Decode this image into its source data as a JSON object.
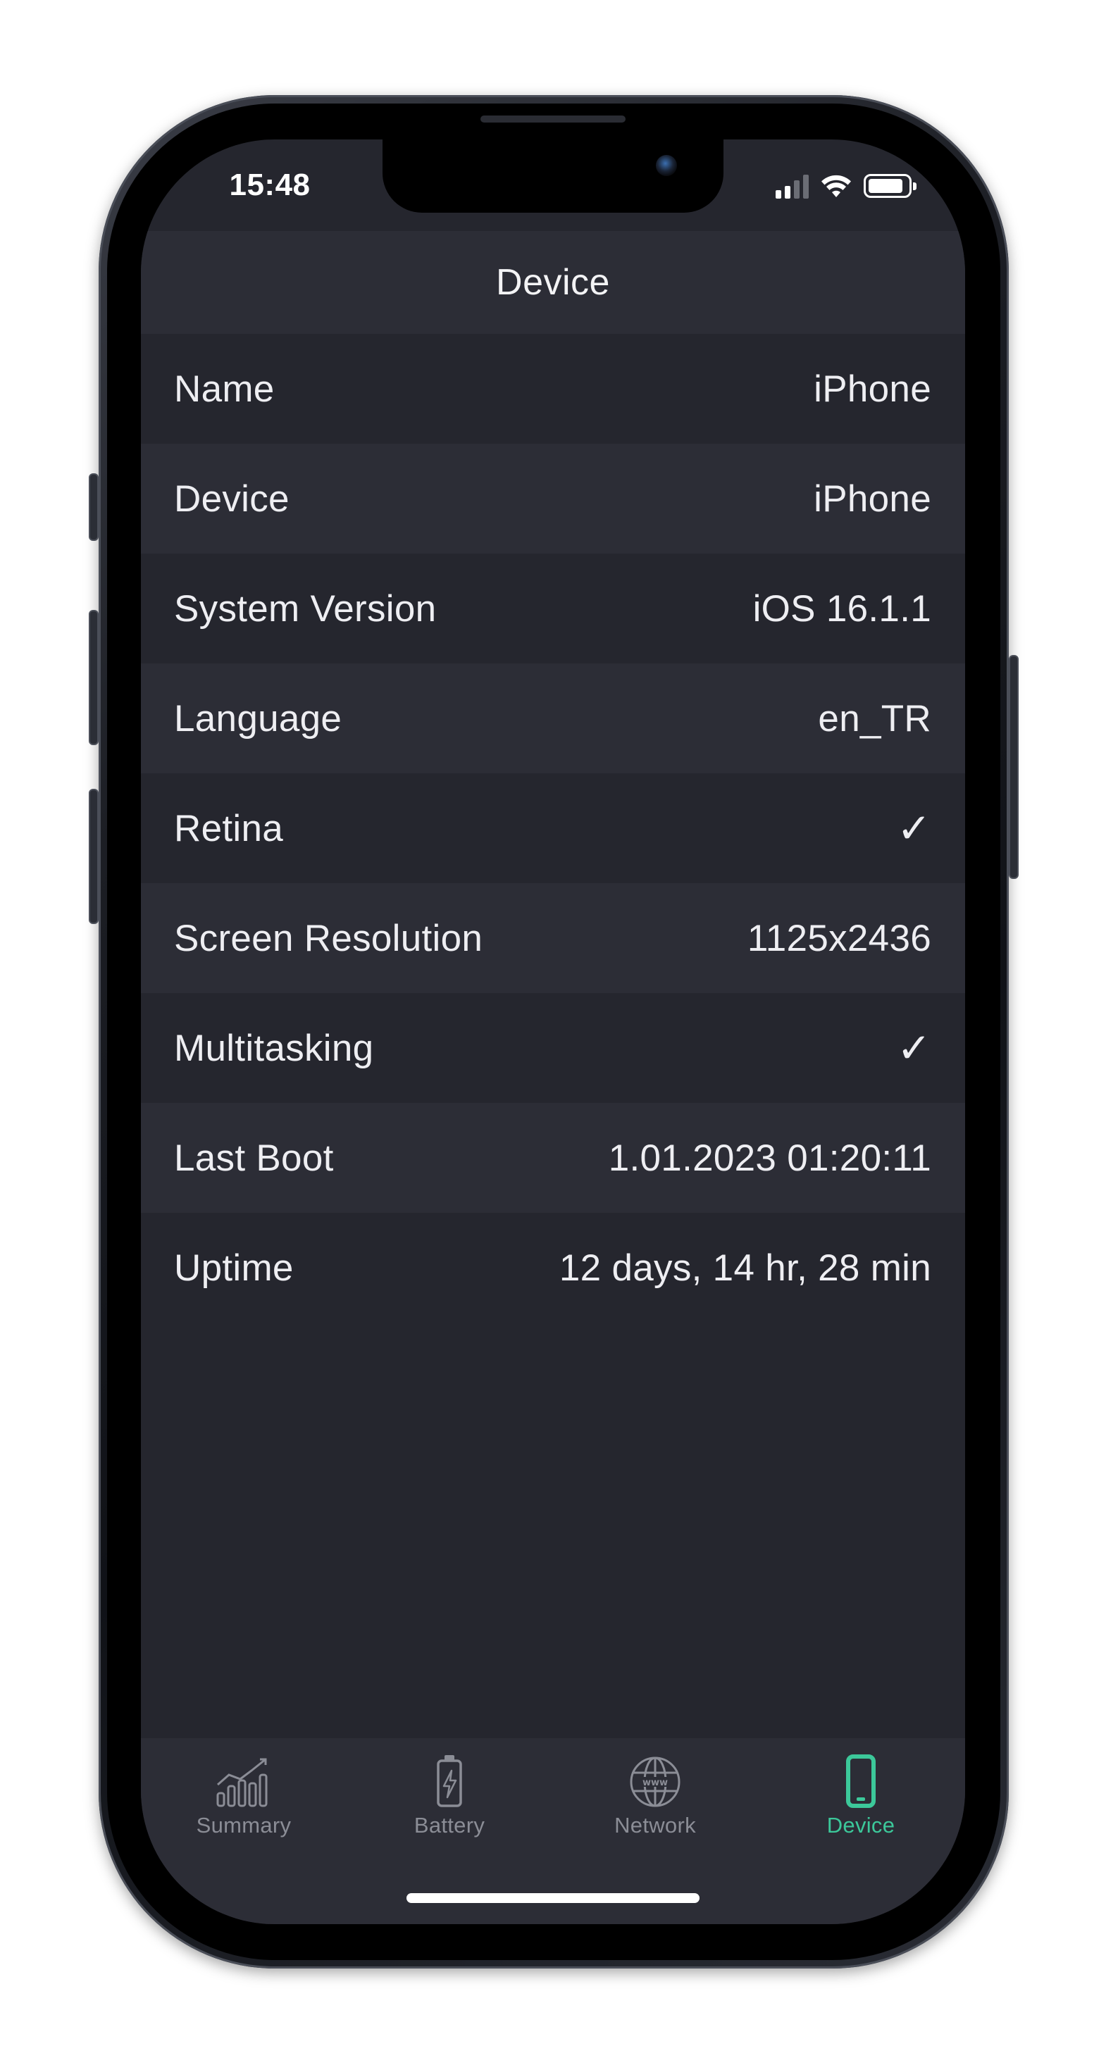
{
  "status_bar": {
    "time": "15:48"
  },
  "nav": {
    "title": "Device"
  },
  "rows": [
    {
      "label": "Name",
      "value": "iPhone"
    },
    {
      "label": "Device",
      "value": "iPhone"
    },
    {
      "label": "System Version",
      "value": "iOS 16.1.1"
    },
    {
      "label": "Language",
      "value": "en_TR"
    },
    {
      "label": "Retina",
      "value": "✓"
    },
    {
      "label": "Screen Resolution",
      "value": "1125x2436"
    },
    {
      "label": "Multitasking",
      "value": "✓"
    },
    {
      "label": "Last Boot",
      "value": "1.01.2023 01:20:11"
    },
    {
      "label": "Uptime",
      "value": "12 days, 14 hr, 28 min"
    }
  ],
  "tabs": [
    {
      "label": "Summary",
      "icon": "chart-bars-icon",
      "active": false
    },
    {
      "label": "Battery",
      "icon": "battery-bolt-icon",
      "active": false
    },
    {
      "label": "Network",
      "icon": "globe-www-icon",
      "active": false
    },
    {
      "label": "Device",
      "icon": "phone-icon",
      "active": true
    }
  ],
  "colors": {
    "accent": "#3cc89a",
    "inactive_tab": "#8b8d96",
    "background": "#25262e",
    "row_alt": "#2c2d36"
  }
}
